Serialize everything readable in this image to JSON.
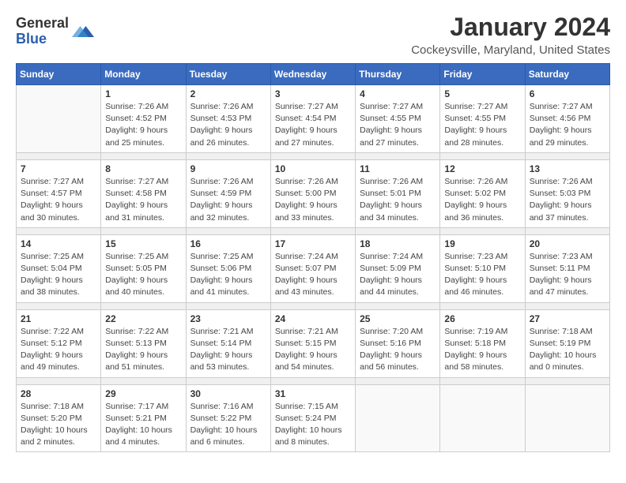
{
  "header": {
    "logo": {
      "general": "General",
      "blue": "Blue"
    },
    "title": "January 2024",
    "subtitle": "Cockeysville, Maryland, United States"
  },
  "calendar": {
    "days_of_week": [
      "Sunday",
      "Monday",
      "Tuesday",
      "Wednesday",
      "Thursday",
      "Friday",
      "Saturday"
    ],
    "weeks": [
      [
        {
          "date": "",
          "info": ""
        },
        {
          "date": "1",
          "info": "Sunrise: 7:26 AM\nSunset: 4:52 PM\nDaylight: 9 hours\nand 25 minutes."
        },
        {
          "date": "2",
          "info": "Sunrise: 7:26 AM\nSunset: 4:53 PM\nDaylight: 9 hours\nand 26 minutes."
        },
        {
          "date": "3",
          "info": "Sunrise: 7:27 AM\nSunset: 4:54 PM\nDaylight: 9 hours\nand 27 minutes."
        },
        {
          "date": "4",
          "info": "Sunrise: 7:27 AM\nSunset: 4:55 PM\nDaylight: 9 hours\nand 27 minutes."
        },
        {
          "date": "5",
          "info": "Sunrise: 7:27 AM\nSunset: 4:55 PM\nDaylight: 9 hours\nand 28 minutes."
        },
        {
          "date": "6",
          "info": "Sunrise: 7:27 AM\nSunset: 4:56 PM\nDaylight: 9 hours\nand 29 minutes."
        }
      ],
      [
        {
          "date": "7",
          "info": "Sunrise: 7:27 AM\nSunset: 4:57 PM\nDaylight: 9 hours\nand 30 minutes."
        },
        {
          "date": "8",
          "info": "Sunrise: 7:27 AM\nSunset: 4:58 PM\nDaylight: 9 hours\nand 31 minutes."
        },
        {
          "date": "9",
          "info": "Sunrise: 7:26 AM\nSunset: 4:59 PM\nDaylight: 9 hours\nand 32 minutes."
        },
        {
          "date": "10",
          "info": "Sunrise: 7:26 AM\nSunset: 5:00 PM\nDaylight: 9 hours\nand 33 minutes."
        },
        {
          "date": "11",
          "info": "Sunrise: 7:26 AM\nSunset: 5:01 PM\nDaylight: 9 hours\nand 34 minutes."
        },
        {
          "date": "12",
          "info": "Sunrise: 7:26 AM\nSunset: 5:02 PM\nDaylight: 9 hours\nand 36 minutes."
        },
        {
          "date": "13",
          "info": "Sunrise: 7:26 AM\nSunset: 5:03 PM\nDaylight: 9 hours\nand 37 minutes."
        }
      ],
      [
        {
          "date": "14",
          "info": "Sunrise: 7:25 AM\nSunset: 5:04 PM\nDaylight: 9 hours\nand 38 minutes."
        },
        {
          "date": "15",
          "info": "Sunrise: 7:25 AM\nSunset: 5:05 PM\nDaylight: 9 hours\nand 40 minutes."
        },
        {
          "date": "16",
          "info": "Sunrise: 7:25 AM\nSunset: 5:06 PM\nDaylight: 9 hours\nand 41 minutes."
        },
        {
          "date": "17",
          "info": "Sunrise: 7:24 AM\nSunset: 5:07 PM\nDaylight: 9 hours\nand 43 minutes."
        },
        {
          "date": "18",
          "info": "Sunrise: 7:24 AM\nSunset: 5:09 PM\nDaylight: 9 hours\nand 44 minutes."
        },
        {
          "date": "19",
          "info": "Sunrise: 7:23 AM\nSunset: 5:10 PM\nDaylight: 9 hours\nand 46 minutes."
        },
        {
          "date": "20",
          "info": "Sunrise: 7:23 AM\nSunset: 5:11 PM\nDaylight: 9 hours\nand 47 minutes."
        }
      ],
      [
        {
          "date": "21",
          "info": "Sunrise: 7:22 AM\nSunset: 5:12 PM\nDaylight: 9 hours\nand 49 minutes."
        },
        {
          "date": "22",
          "info": "Sunrise: 7:22 AM\nSunset: 5:13 PM\nDaylight: 9 hours\nand 51 minutes."
        },
        {
          "date": "23",
          "info": "Sunrise: 7:21 AM\nSunset: 5:14 PM\nDaylight: 9 hours\nand 53 minutes."
        },
        {
          "date": "24",
          "info": "Sunrise: 7:21 AM\nSunset: 5:15 PM\nDaylight: 9 hours\nand 54 minutes."
        },
        {
          "date": "25",
          "info": "Sunrise: 7:20 AM\nSunset: 5:16 PM\nDaylight: 9 hours\nand 56 minutes."
        },
        {
          "date": "26",
          "info": "Sunrise: 7:19 AM\nSunset: 5:18 PM\nDaylight: 9 hours\nand 58 minutes."
        },
        {
          "date": "27",
          "info": "Sunrise: 7:18 AM\nSunset: 5:19 PM\nDaylight: 10 hours\nand 0 minutes."
        }
      ],
      [
        {
          "date": "28",
          "info": "Sunrise: 7:18 AM\nSunset: 5:20 PM\nDaylight: 10 hours\nand 2 minutes."
        },
        {
          "date": "29",
          "info": "Sunrise: 7:17 AM\nSunset: 5:21 PM\nDaylight: 10 hours\nand 4 minutes."
        },
        {
          "date": "30",
          "info": "Sunrise: 7:16 AM\nSunset: 5:22 PM\nDaylight: 10 hours\nand 6 minutes."
        },
        {
          "date": "31",
          "info": "Sunrise: 7:15 AM\nSunset: 5:24 PM\nDaylight: 10 hours\nand 8 minutes."
        },
        {
          "date": "",
          "info": ""
        },
        {
          "date": "",
          "info": ""
        },
        {
          "date": "",
          "info": ""
        }
      ]
    ]
  }
}
